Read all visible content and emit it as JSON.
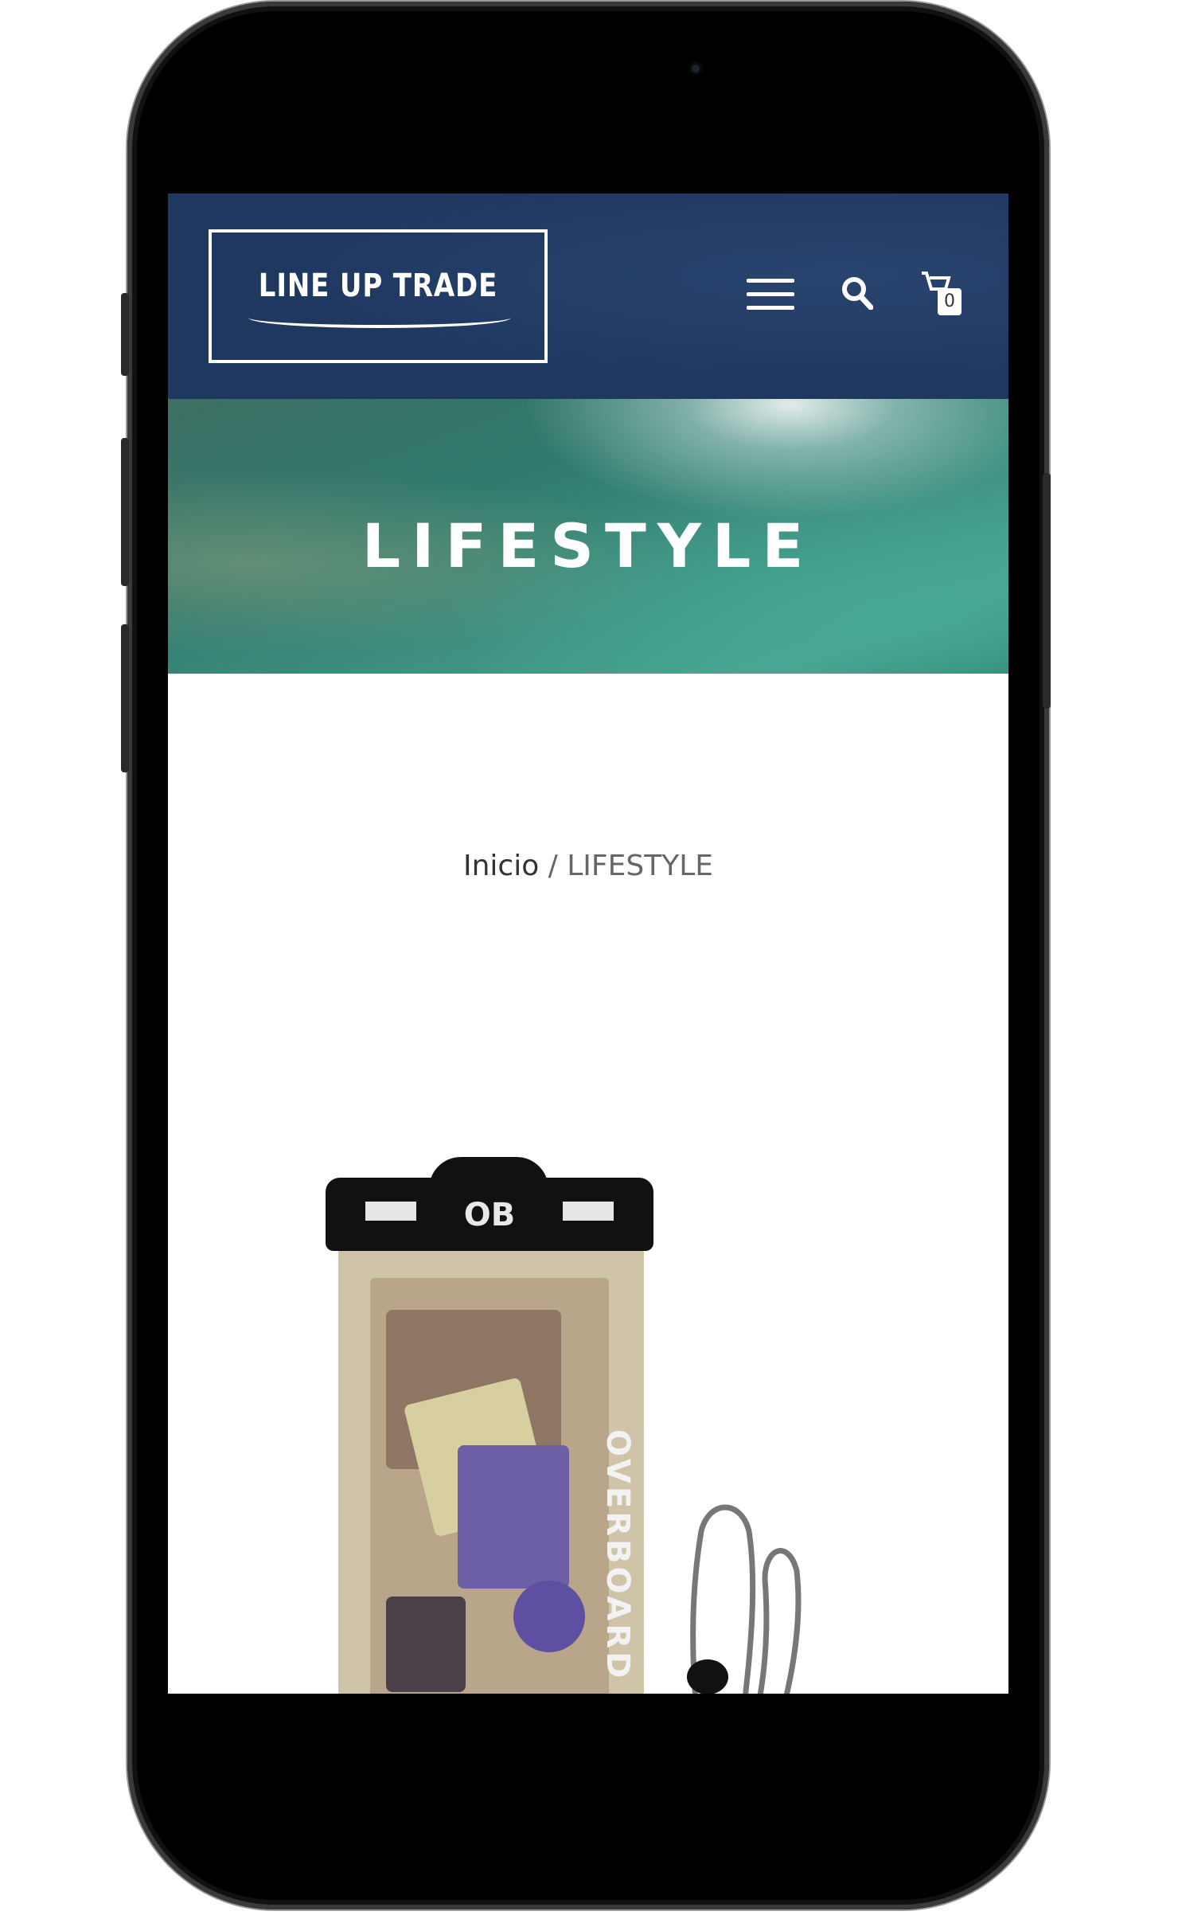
{
  "header": {
    "logo_text": "LINE UP TRADE",
    "cart_count": "0",
    "colors": {
      "bar": "#1f3860",
      "foreground": "#ffffff"
    }
  },
  "hero": {
    "title": "LIFESTYLE"
  },
  "breadcrumb": {
    "home": "Inicio",
    "separator": " / ",
    "current": "LIFESTYLE"
  },
  "product": {
    "brand_top": "OB",
    "brand_side": "OVERBOARD"
  }
}
